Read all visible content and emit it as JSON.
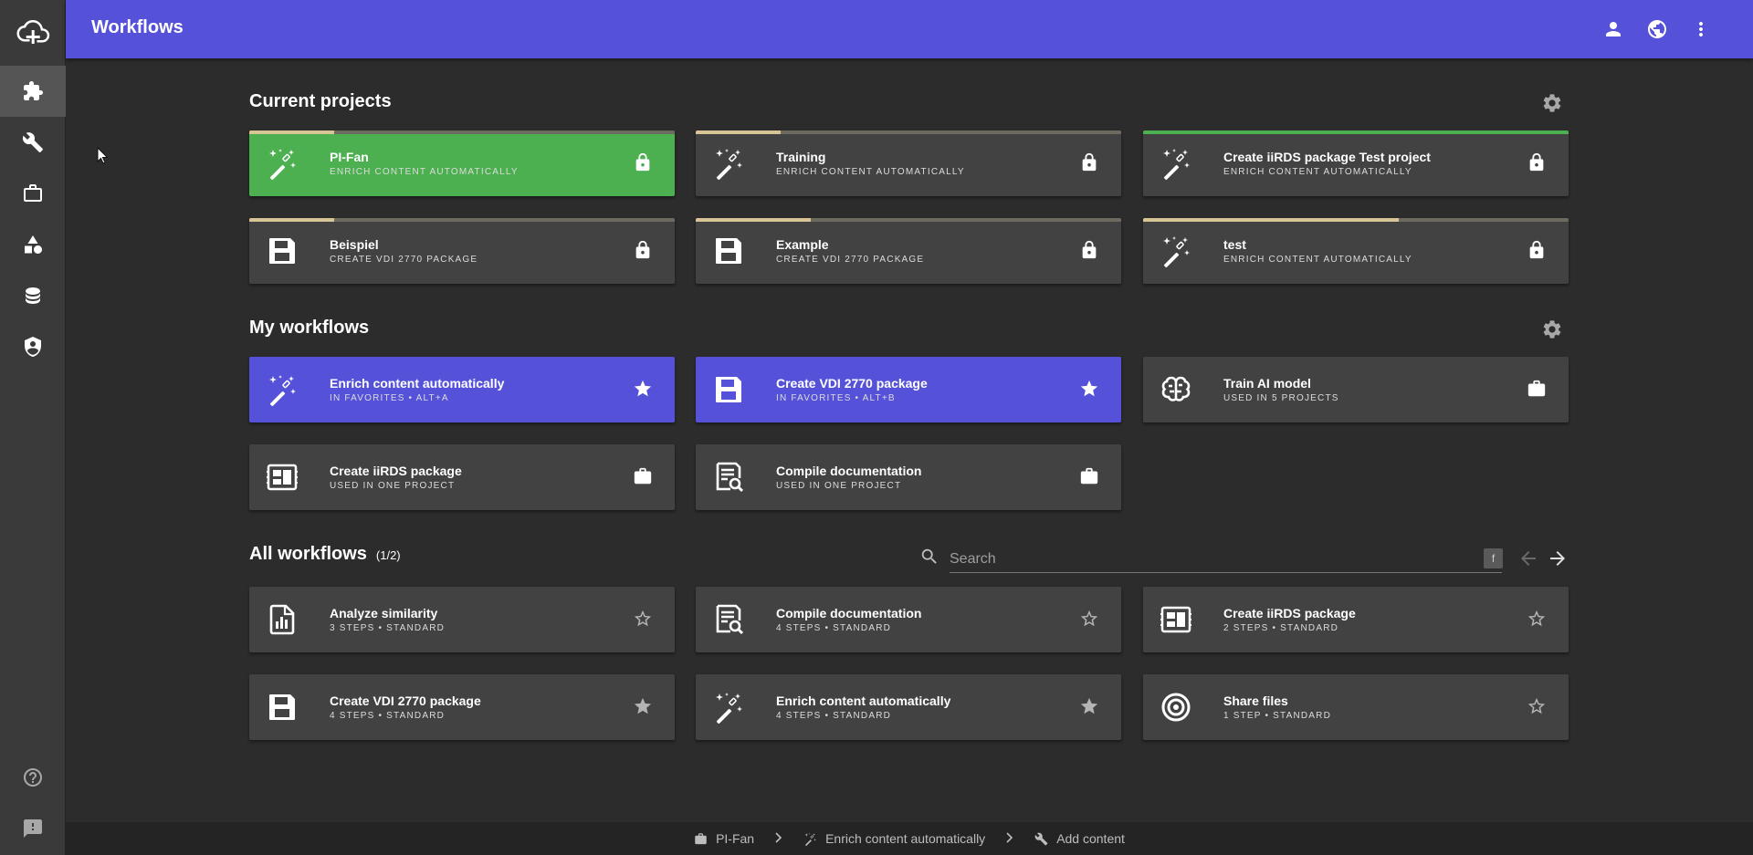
{
  "header": {
    "title": "Workflows"
  },
  "sidebar": {
    "items": [
      {
        "icon": "puzzle-icon",
        "active": true
      },
      {
        "icon": "wrench-icon"
      },
      {
        "icon": "briefcase-icon"
      },
      {
        "icon": "shapes-icon"
      },
      {
        "icon": "database-icon"
      },
      {
        "icon": "shield-icon"
      }
    ],
    "bottom": [
      {
        "icon": "help-icon"
      },
      {
        "icon": "feedback-icon"
      }
    ]
  },
  "current_projects": {
    "title": "Current projects",
    "cards": [
      {
        "name": "PI-Fan",
        "sub": "Enrich content automatically",
        "icon": "magic-wand-icon",
        "style": "green",
        "progress": 0.2,
        "action": "lock-icon"
      },
      {
        "name": "Training",
        "sub": "Enrich content automatically",
        "icon": "magic-wand-icon",
        "style": "dark",
        "progress": 0.2,
        "action": "lock-icon"
      },
      {
        "name": "Create iiRDS package Test project",
        "sub": "Enrich content automatically",
        "icon": "magic-wand-icon",
        "style": "dark",
        "progress": 1.0,
        "action": "lock-icon"
      },
      {
        "name": "Beispiel",
        "sub": "Create VDI 2770 package",
        "icon": "save-icon",
        "style": "dark",
        "progress": 0.2,
        "action": "lock-icon"
      },
      {
        "name": "Example",
        "sub": "Create VDI 2770 package",
        "icon": "save-icon",
        "style": "dark",
        "progress": 0.27,
        "action": "lock-icon"
      },
      {
        "name": "test",
        "sub": "Enrich content automatically",
        "icon": "magic-wand-icon",
        "style": "dark",
        "progress": 0.6,
        "action": "lock-icon"
      }
    ]
  },
  "my_workflows": {
    "title": "My workflows",
    "cards": [
      {
        "name": "Enrich content automatically",
        "sub": "In favorites • Alt+A",
        "icon": "magic-wand-icon",
        "style": "blue",
        "action": "star-filled-icon"
      },
      {
        "name": "Create VDI 2770 package",
        "sub": "In favorites • Alt+B",
        "icon": "save-icon",
        "style": "blue",
        "action": "star-filled-icon"
      },
      {
        "name": "Train AI model",
        "sub": "Used in 5 projects",
        "icon": "brain-icon",
        "style": "dark",
        "action": "briefcase-icon"
      },
      {
        "name": "Create iiRDS package",
        "sub": "Used in one project",
        "icon": "package-icon",
        "style": "dark",
        "action": "briefcase-icon"
      },
      {
        "name": "Compile documentation",
        "sub": "Used in one project",
        "icon": "document-search-icon",
        "style": "dark",
        "action": "briefcase-icon"
      }
    ]
  },
  "all_workflows": {
    "title": "All workflows",
    "count": "(1/2)",
    "search": {
      "placeholder": "Search",
      "shortcut": "f"
    },
    "cards": [
      {
        "name": "Analyze similarity",
        "sub": "3 steps • Standard",
        "icon": "chart-file-icon",
        "action": "star-outline-icon"
      },
      {
        "name": "Compile documentation",
        "sub": "4 steps • Standard",
        "icon": "document-search-icon",
        "action": "star-outline-icon"
      },
      {
        "name": "Create iiRDS package",
        "sub": "2 steps • Standard",
        "icon": "package-icon",
        "action": "star-outline-icon"
      },
      {
        "name": "Create VDI 2770 package",
        "sub": "4 steps • Standard",
        "icon": "save-icon",
        "action": "star-filled-icon"
      },
      {
        "name": "Enrich content automatically",
        "sub": "4 steps • Standard",
        "icon": "magic-wand-icon",
        "action": "star-filled-icon"
      },
      {
        "name": "Share files",
        "sub": "1 step • Standard",
        "icon": "target-icon",
        "action": "star-outline-icon"
      }
    ]
  },
  "breadcrumb": [
    {
      "label": "PI-Fan",
      "icon": "briefcase-icon"
    },
    {
      "label": "Enrich content automatically",
      "icon": "magic-wand-icon"
    },
    {
      "label": "Add content",
      "icon": "wrench-icon"
    }
  ]
}
